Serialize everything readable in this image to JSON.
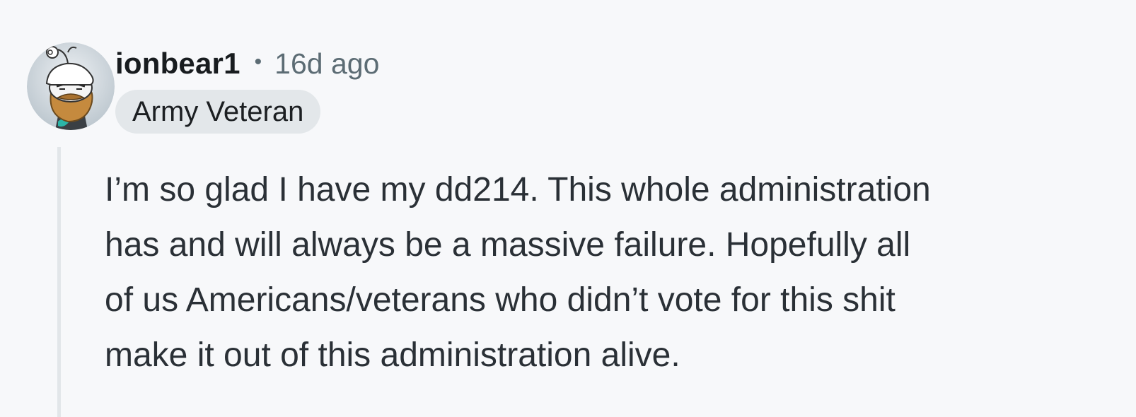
{
  "comment": {
    "author": "ionbear1",
    "separator": "•",
    "time_ago": "16d ago",
    "flair": "Army Veteran",
    "avatar_icon": "snoo-avatar-icon",
    "body_lines": [
      "I’m so glad I have my dd214. This whole administration",
      "has and will always be a massive failure. Hopefully all",
      "of us Americans/veterans who didn’t vote for this shit",
      "make it out of this administration alive."
    ]
  },
  "colors": {
    "background": "#f7f8fa",
    "flair_bg": "#e3e7ea",
    "muted_text": "#5c6c74",
    "thread_line": "#e2e6e9"
  }
}
